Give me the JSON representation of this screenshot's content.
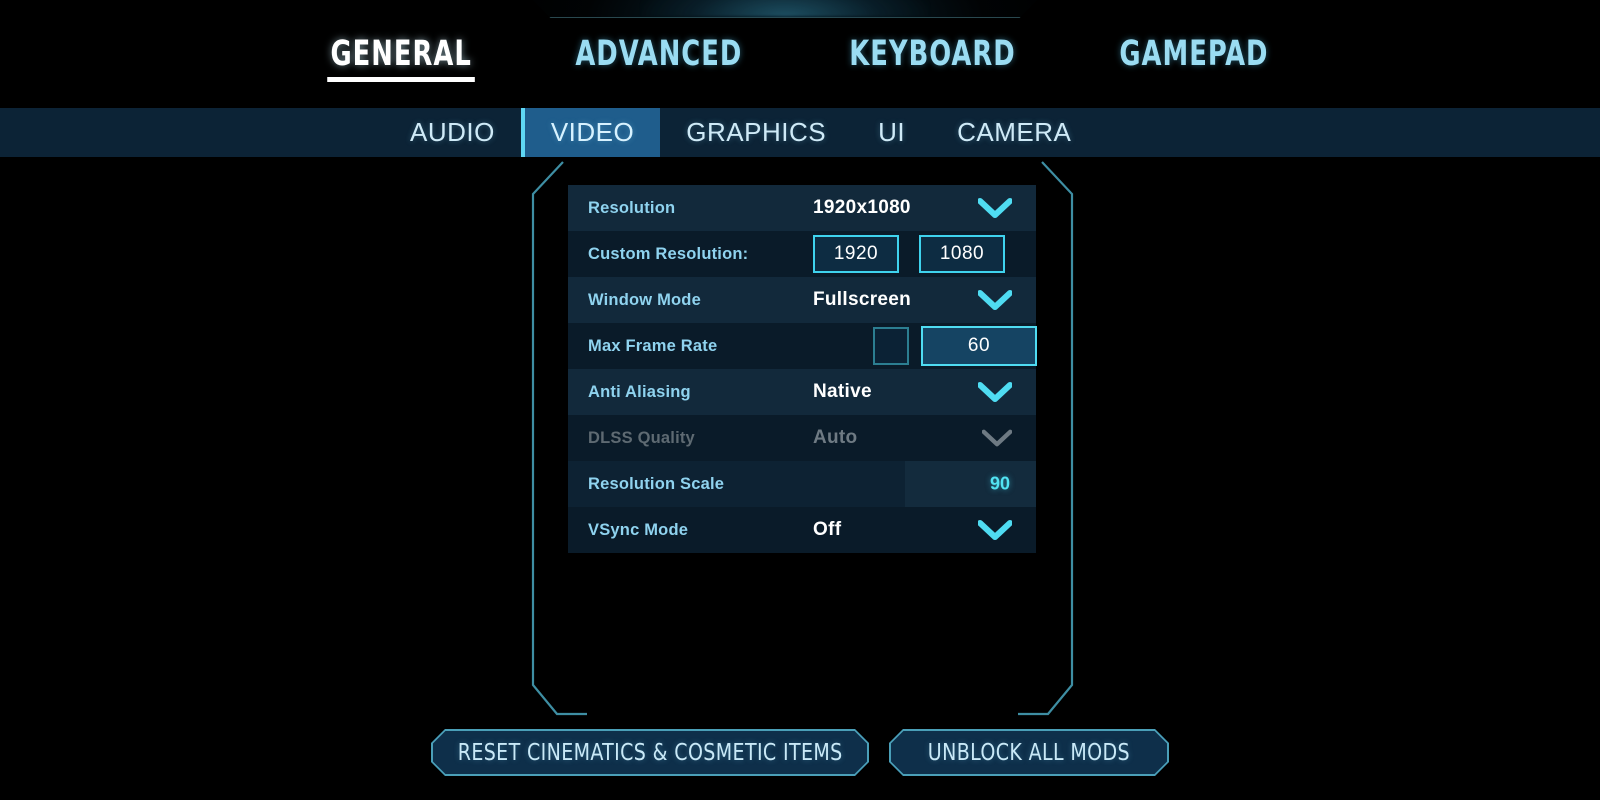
{
  "main_tabs": [
    {
      "label": "GENERAL",
      "active": true
    },
    {
      "label": "ADVANCED",
      "active": false
    },
    {
      "label": "KEYBOARD",
      "active": false
    },
    {
      "label": "GAMEPAD",
      "active": false
    }
  ],
  "sub_tabs": [
    {
      "label": "AUDIO",
      "active": false
    },
    {
      "label": "VIDEO",
      "active": true
    },
    {
      "label": "GRAPHICS",
      "active": false
    },
    {
      "label": "UI",
      "active": false
    },
    {
      "label": "CAMERA",
      "active": false
    }
  ],
  "settings": {
    "resolution": {
      "label": "Resolution",
      "value": "1920x1080"
    },
    "custom_resolution": {
      "label": "Custom Resolution:",
      "width": "1920",
      "height": "1080"
    },
    "window_mode": {
      "label": "Window Mode",
      "value": "Fullscreen"
    },
    "max_frame_rate": {
      "label": "Max Frame Rate",
      "value": "60",
      "checkbox": ""
    },
    "anti_aliasing": {
      "label": "Anti Aliasing",
      "value": "Native"
    },
    "dlss_quality": {
      "label": "DLSS Quality",
      "value": "Auto"
    },
    "resolution_scale": {
      "label": "Resolution Scale",
      "value": "90",
      "percent": 72
    },
    "vsync_mode": {
      "label": "VSync Mode",
      "value": "Off"
    }
  },
  "buttons": {
    "reset": "RESET CINEMATICS & COSMETIC ITEMS",
    "unblock": "UNBLOCK ALL MODS"
  },
  "colors": {
    "accent_cyan": "#4fdcf2",
    "label_blue": "#8fd3ef",
    "active_tab_blue": "#1f5d8c",
    "row_odd": "#12293b",
    "row_even": "#0a1b29",
    "disabled_gray": "#6e7a83"
  }
}
